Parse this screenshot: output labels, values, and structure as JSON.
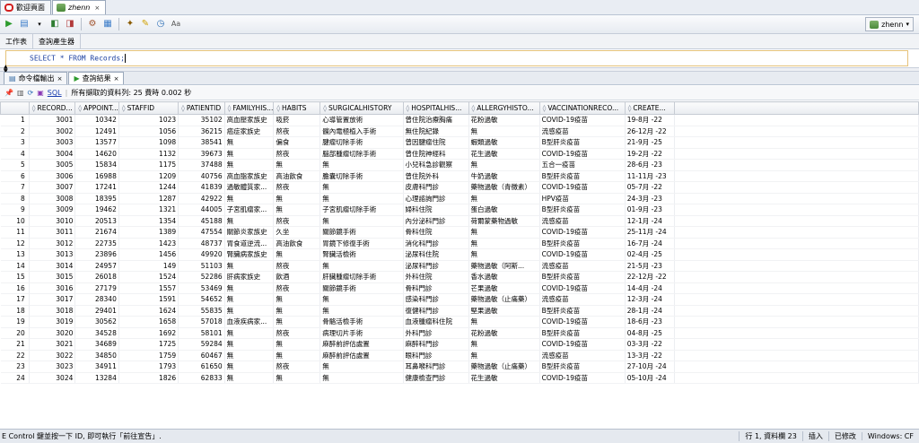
{
  "doc_tabs": [
    {
      "label": "歡迎頁面",
      "icon": "oracle-logo-icon",
      "closable": false
    },
    {
      "label": "zhenn",
      "icon": "database-connection-icon",
      "closable": true
    }
  ],
  "connection": {
    "label": "zhenn"
  },
  "editor_tabs": [
    {
      "label": "工作表"
    },
    {
      "label": "查詢產生器"
    }
  ],
  "sql_text": "SELECT * FROM Records;",
  "panel_tabs": [
    {
      "label": "命令檔輸出",
      "closable": true
    },
    {
      "label": "查詢結果",
      "closable": true
    }
  ],
  "result_bar": {
    "sql_link": "SQL",
    "message": "所有擷取的資料列: 25 費時 0.002 秒"
  },
  "columns": [
    "RECORD...",
    "APPOINT...",
    "STAFFID",
    "PATIENTID",
    "FAMILYHIS...",
    "HABITS",
    "SURGICALHISTORY",
    "HOSPITALHIS...",
    "ALLERGYHISTO...",
    "VACCINATIONRECO...",
    "CREATE..."
  ],
  "rows": [
    {
      "n": "1",
      "c": [
        "3001",
        "10342",
        "1023",
        "35102",
        "高血壓家族史",
        "吸菸",
        "心導管置放術",
        "曾住院治療胸痛",
        "花粉過敏",
        "COVID-19疫苗",
        "19-8月 -22"
      ]
    },
    {
      "n": "2",
      "c": [
        "3002",
        "12491",
        "1056",
        "36215",
        "癌症家族史",
        "熬夜",
        "髖內電極植入手術",
        "無住院紀錄",
        "無",
        "流感疫苗",
        "26-12月 -22"
      ]
    },
    {
      "n": "3",
      "c": [
        "3003",
        "13577",
        "1098",
        "38541",
        "無",
        "偏食",
        "腱瘤切除手術",
        "曾因腱瘤住院",
        "蝦類過敏",
        "B型肝炎疫苗",
        "21-9月 -25"
      ]
    },
    {
      "n": "4",
      "c": [
        "3004",
        "14620",
        "1132",
        "39673",
        "無",
        "熬夜",
        "腦部腫瘤切除手術",
        "曾住院神經科",
        "花生過敏",
        "COVID-19疫苗",
        "19-2月 -22"
      ]
    },
    {
      "n": "5",
      "c": [
        "3005",
        "15834",
        "1175",
        "37488",
        "無",
        "無",
        "無",
        "小兒科急診觀察",
        "無",
        "五合一疫苗",
        "28-6月 -23"
      ]
    },
    {
      "n": "6",
      "c": [
        "3006",
        "16988",
        "1209",
        "40756",
        "高血脂家族史",
        "高油飲食",
        "膽囊切除手術",
        "曾住院外科",
        "牛奶過敏",
        "B型肝炎疫苗",
        "11-11月 -23"
      ]
    },
    {
      "n": "7",
      "c": [
        "3007",
        "17241",
        "1244",
        "41839",
        "過敏體質家...",
        "熬夜",
        "無",
        "皮膚科門診",
        "藥物過敏（青黴素）",
        "COVID-19疫苗",
        "05-7月 -22"
      ]
    },
    {
      "n": "8",
      "c": [
        "3008",
        "18395",
        "1287",
        "42922",
        "無",
        "無",
        "無",
        "心理諮詢門診",
        "無",
        "HPV疫苗",
        "24-3月 -23"
      ]
    },
    {
      "n": "9",
      "c": [
        "3009",
        "19462",
        "1321",
        "44005",
        "子宮肌瘤家...",
        "無",
        "子宮肌瘤切除手術",
        "婦科住院",
        "蛋白過敏",
        "B型肝炎疫苗",
        "01-9月 -23"
      ]
    },
    {
      "n": "10",
      "c": [
        "3010",
        "20513",
        "1354",
        "45188",
        "無",
        "熬夜",
        "無",
        "內分泌科門診",
        "荷爾蒙藥物過敏",
        "流感疫苗",
        "12-1月 -24"
      ]
    },
    {
      "n": "11",
      "c": [
        "3011",
        "21674",
        "1389",
        "47554",
        "關節炎家族史",
        "久坐",
        "關節鏡手術",
        "骨科住院",
        "無",
        "COVID-19疫苗",
        "25-11月 -24"
      ]
    },
    {
      "n": "12",
      "c": [
        "3012",
        "22735",
        "1423",
        "48737",
        "胃食道逆流...",
        "高油飲食",
        "胃鏡下修復手術",
        "消化科門診",
        "無",
        "B型肝炎疫苗",
        "16-7月 -24"
      ]
    },
    {
      "n": "13",
      "c": [
        "3013",
        "23896",
        "1456",
        "49920",
        "腎臟病家族史",
        "無",
        "腎臟活檢術",
        "泌尿科住院",
        "無",
        "COVID-19疫苗",
        "02-4月 -25"
      ]
    },
    {
      "n": "14",
      "c": [
        "3014",
        "24957",
        "149",
        "51103",
        "無",
        "熬夜",
        "無",
        "泌尿科門診",
        "藥物過敏（阿斯...",
        "流感疫苗",
        "21-5月 -23"
      ]
    },
    {
      "n": "15",
      "c": [
        "3015",
        "26018",
        "1524",
        "52286",
        "肝病家族史",
        "飲酒",
        "肝臟腫瘤切除手術",
        "外科住院",
        "香水過敏",
        "B型肝炎疫苗",
        "22-12月 -22"
      ]
    },
    {
      "n": "16",
      "c": [
        "3016",
        "27179",
        "1557",
        "53469",
        "無",
        "熬夜",
        "關節鏡手術",
        "骨科門診",
        "芒果過敏",
        "COVID-19疫苗",
        "14-4月 -24"
      ]
    },
    {
      "n": "17",
      "c": [
        "3017",
        "28340",
        "1591",
        "54652",
        "無",
        "無",
        "無",
        "感染科門診",
        "藥物過敏（止痛藥）",
        "流感疫苗",
        "12-3月 -24"
      ]
    },
    {
      "n": "18",
      "c": [
        "3018",
        "29401",
        "1624",
        "55835",
        "無",
        "無",
        "無",
        "復健科門診",
        "堅果過敏",
        "B型肝炎疫苗",
        "28-1月 -24"
      ]
    },
    {
      "n": "19",
      "c": [
        "3019",
        "30562",
        "1658",
        "57018",
        "血液疾病家...",
        "無",
        "骨骼活檢手術",
        "血液腫瘤科住院",
        "無",
        "COVID-19疫苗",
        "18-6月 -23"
      ]
    },
    {
      "n": "20",
      "c": [
        "3020",
        "34528",
        "1692",
        "58101",
        "無",
        "熬夜",
        "病理切片手術",
        "外科門診",
        "花粉過敏",
        "B型肝炎疫苗",
        "04-8月 -25"
      ]
    },
    {
      "n": "21",
      "c": [
        "3021",
        "34689",
        "1725",
        "59284",
        "無",
        "無",
        "麻醉前評估處置",
        "麻醉科門診",
        "無",
        "COVID-19疫苗",
        "03-3月 -22"
      ]
    },
    {
      "n": "22",
      "c": [
        "3022",
        "34850",
        "1759",
        "60467",
        "無",
        "無",
        "麻醉前評估處置",
        "眼科門診",
        "無",
        "流感疫苗",
        "13-3月 -22"
      ]
    },
    {
      "n": "23",
      "c": [
        "3023",
        "34911",
        "1793",
        "61650",
        "無",
        "熬夜",
        "無",
        "耳鼻喉科門診",
        "藥物過敏（止痛藥）",
        "B型肝炎疫苗",
        "27-10月 -24"
      ]
    },
    {
      "n": "24",
      "c": [
        "3024",
        "13284",
        "1826",
        "62833",
        "無",
        "無",
        "無",
        "健康檢查門診",
        "花生過敏",
        "COVID-19疫苗",
        "05-10月 -24"
      ]
    }
  ],
  "status_bar": {
    "message": "E Control 鍵並按一下 ID, 即可執行「前往宣告」.",
    "position": "行 1, 資料欄 23",
    "mode": "插入",
    "modified": "已修改",
    "platform": "Windows: CF"
  }
}
